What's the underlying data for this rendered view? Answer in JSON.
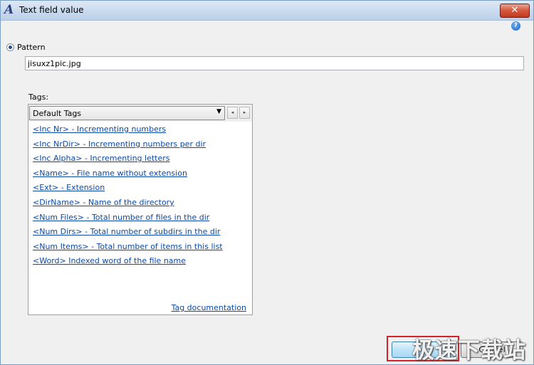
{
  "window": {
    "title": "Text field value",
    "app_icon": "text-script-icon",
    "close_glyph": "✕"
  },
  "help": {
    "icon": "help-icon",
    "glyph": "?"
  },
  "pattern": {
    "label": "Pattern",
    "selected": true,
    "value": "jisuxz1pic.jpg"
  },
  "tags": {
    "label": "Tags:",
    "select_value": "Default Tags",
    "prev_glyph": "◂",
    "next_glyph": "▸",
    "items": [
      {
        "label": "<Inc Nr> - Incrementing numbers"
      },
      {
        "label": "<Inc NrDir> - Incrementing numbers per dir"
      },
      {
        "label": "<Inc Alpha> - Incrementing letters"
      },
      {
        "label": "<Name> - File name without extension"
      },
      {
        "label": "<Ext> - Extension"
      },
      {
        "label": "<DirName> - Name of the directory"
      },
      {
        "label": "<Num Files> - Total number of files in the dir"
      },
      {
        "label": "<Num Dirs> - Total number of subdirs in the dir"
      },
      {
        "label": "<Num Items> - Total number of items in this list"
      },
      {
        "label": "<Word> Indexed word of the file name"
      }
    ],
    "doc_link": "Tag documentation"
  },
  "buttons": {
    "ok_label": "",
    "cancel_label": "Cancel"
  },
  "watermark": "极速下载站",
  "colors": {
    "link": "#0b49a8",
    "highlight_border": "#d4222a",
    "close_button": "#c23a20"
  }
}
